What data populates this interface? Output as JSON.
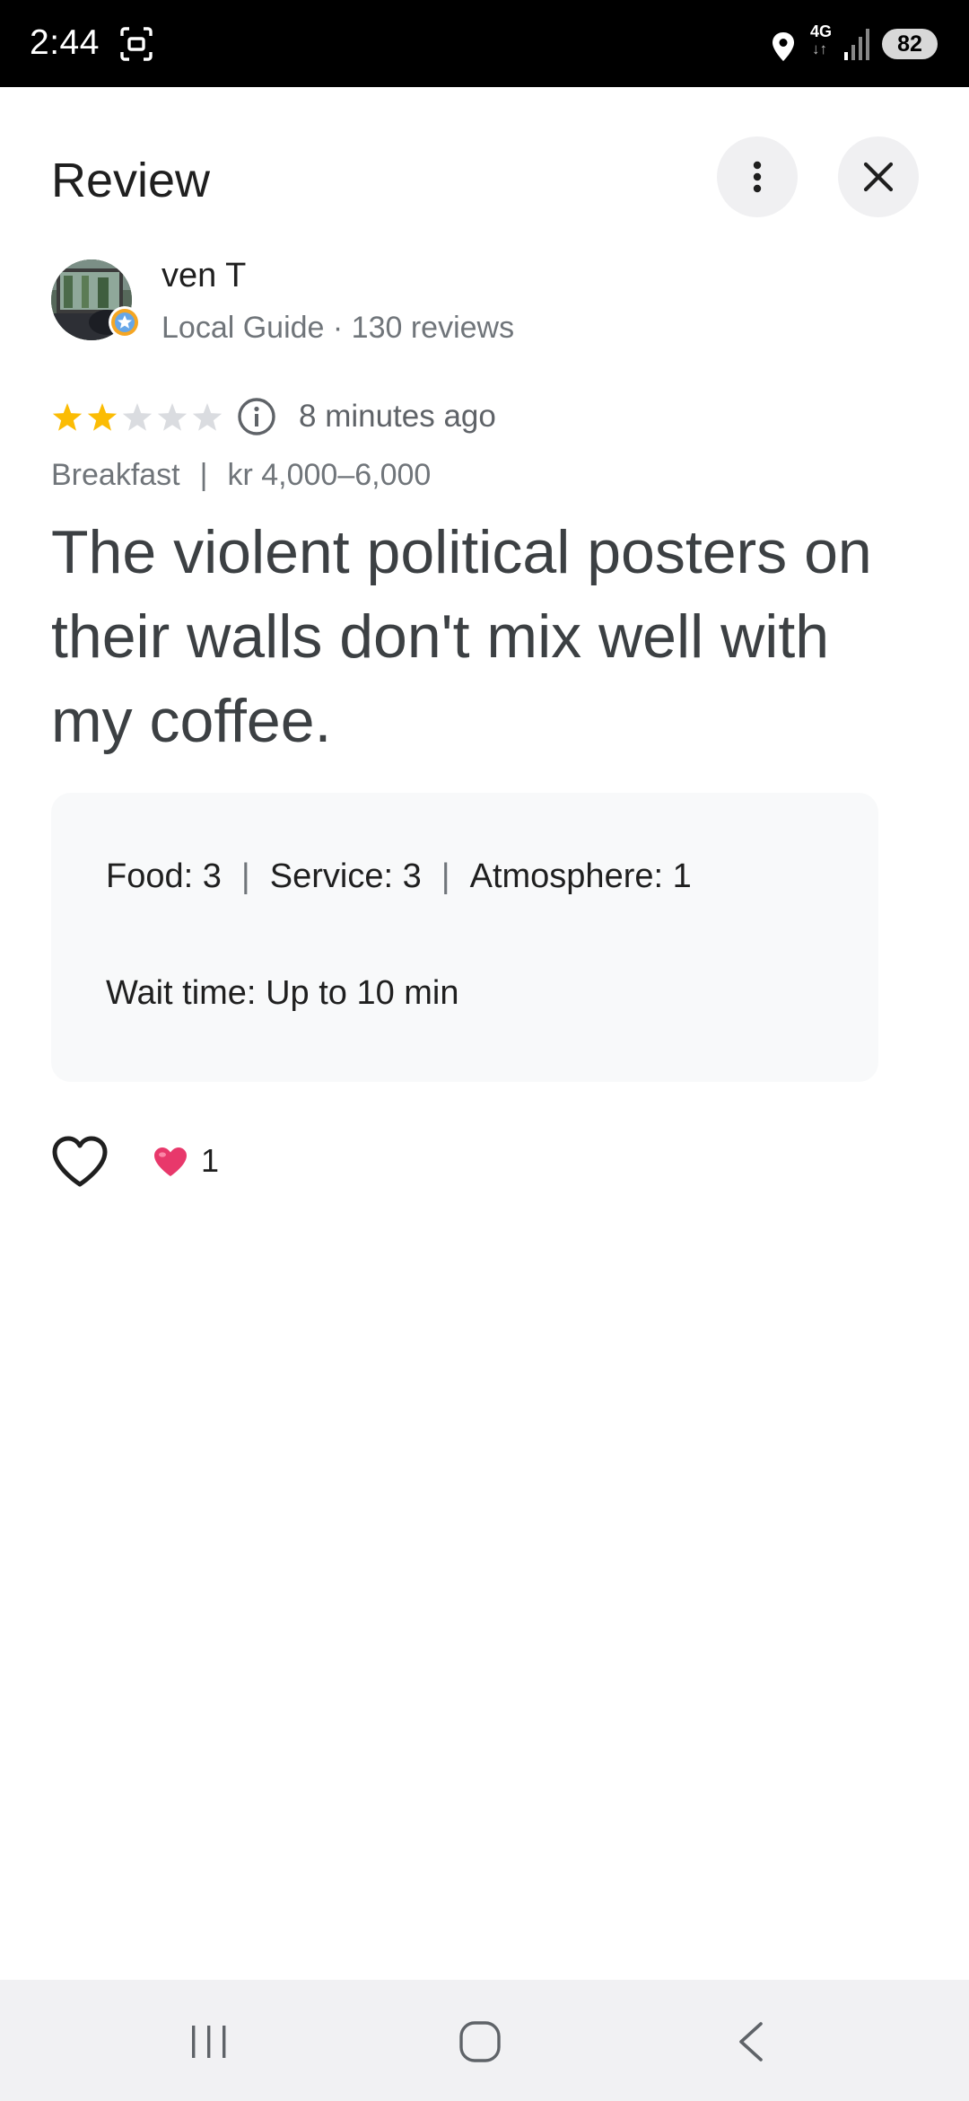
{
  "status_bar": {
    "time": "2:44",
    "network": "4G",
    "battery": "82"
  },
  "header": {
    "title": "Review"
  },
  "reviewer": {
    "name": "ven T",
    "meta": "Local Guide · 130 reviews",
    "badge": "local-guide-star-icon"
  },
  "rating": {
    "stars": 2,
    "max_stars": 5,
    "time_ago": "8 minutes ago",
    "star_color": "#fbbc04",
    "empty_star_color": "#dadce0"
  },
  "tags": {
    "meal": "Breakfast",
    "separator": "|",
    "price": "kr 4,000–6,000"
  },
  "review": {
    "text": "The violent political posters on their walls don't mix well with my coffee."
  },
  "attributes": {
    "food_label": "Food:",
    "food_value": "3",
    "service_label": "Service:",
    "service_value": "3",
    "atmosphere_label": "Atmosphere:",
    "atmosphere_value": "1",
    "divider": "|",
    "wait_label": "Wait time:",
    "wait_value": "Up to 10 min"
  },
  "reactions": {
    "count": "1",
    "heart_color": "#e8386b"
  }
}
